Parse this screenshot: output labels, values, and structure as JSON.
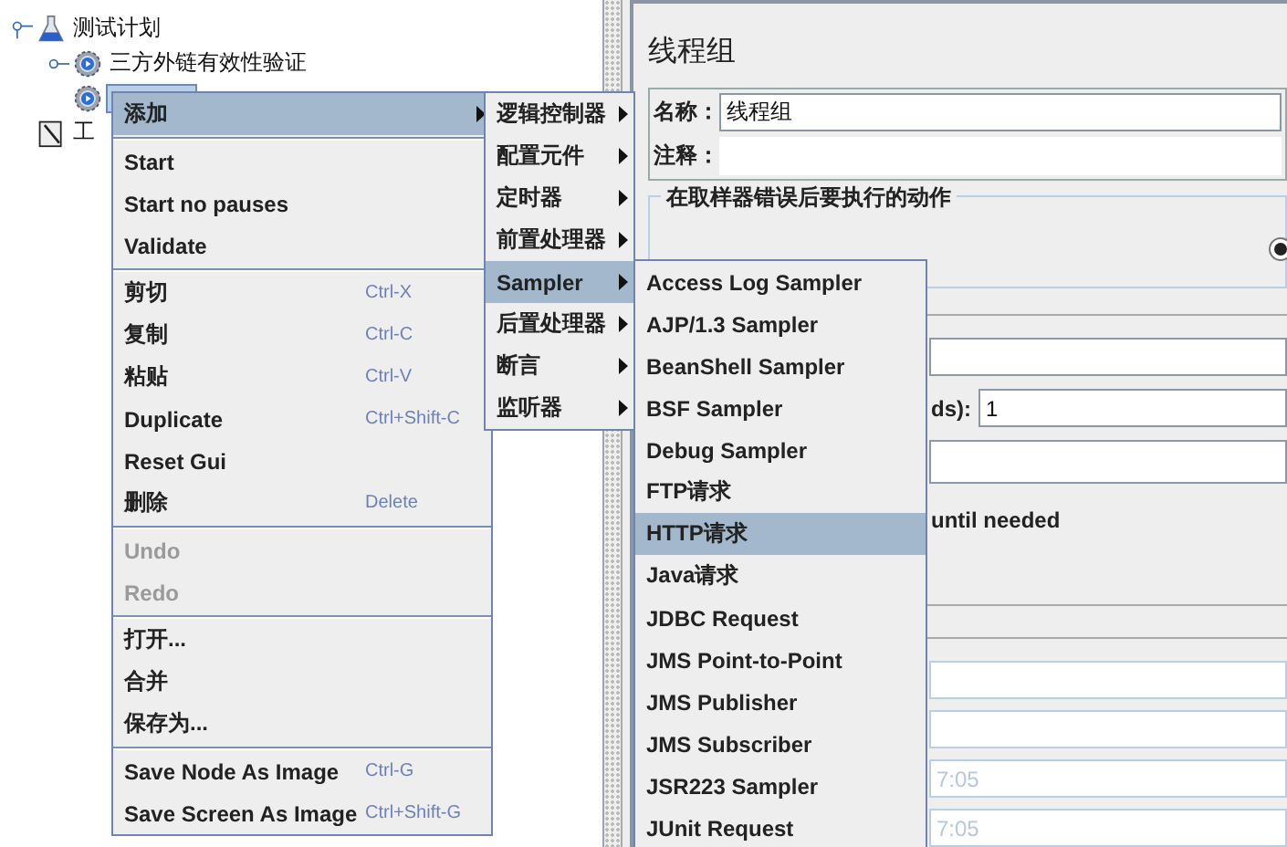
{
  "tree": {
    "items": [
      {
        "label": "测试计划",
        "kind": "plan",
        "selected": false,
        "expanded": true,
        "children": [
          {
            "label": "三方外链有效性验证",
            "kind": "thread-group",
            "selected": false,
            "expanded": false
          },
          {
            "kind": "thread-group",
            "selected": true
          }
        ]
      },
      {
        "label": "工",
        "kind": "workbench",
        "selected": false
      }
    ]
  },
  "panel": {
    "title": "线程组",
    "name_label": "名称：",
    "name_value": "线程组",
    "comment_label": "注释：",
    "error_group": {
      "legend": "在取样器错误后要执行的动作",
      "radio_selected": true
    },
    "threads_label": "ds):",
    "threads_value": "1",
    "delay_label": "until needed",
    "time_fields": [
      "7:05",
      "7:05"
    ]
  },
  "context_menu": {
    "groups": [
      [
        {
          "label": "添加",
          "selected": true,
          "disabled": false,
          "has_submenu": true
        }
      ],
      [
        {
          "label": "Start",
          "selected": false,
          "disabled": false,
          "has_submenu": false
        },
        {
          "label": "Start no pauses",
          "selected": false,
          "disabled": false,
          "has_submenu": false
        },
        {
          "label": "Validate",
          "selected": false,
          "disabled": false,
          "has_submenu": false
        }
      ],
      [
        {
          "label": "剪切",
          "shortcut": "Ctrl-X",
          "selected": false,
          "disabled": false,
          "has_submenu": false
        },
        {
          "label": "复制",
          "shortcut": "Ctrl-C",
          "selected": false,
          "disabled": false,
          "has_submenu": false
        },
        {
          "label": "粘贴",
          "shortcut": "Ctrl-V",
          "selected": false,
          "disabled": false,
          "has_submenu": false
        },
        {
          "label": "Duplicate",
          "shortcut": "Ctrl+Shift-C",
          "selected": false,
          "disabled": false,
          "has_submenu": false
        },
        {
          "label": "Reset Gui",
          "selected": false,
          "disabled": false,
          "has_submenu": false
        },
        {
          "label": "删除",
          "shortcut": "Delete",
          "selected": false,
          "disabled": false,
          "has_submenu": false
        }
      ],
      [
        {
          "label": "Undo",
          "selected": false,
          "disabled": true,
          "has_submenu": false
        },
        {
          "label": "Redo",
          "selected": false,
          "disabled": true,
          "has_submenu": false
        }
      ],
      [
        {
          "label": "打开...",
          "selected": false,
          "disabled": false,
          "has_submenu": false
        },
        {
          "label": "合并",
          "selected": false,
          "disabled": false,
          "has_submenu": false
        },
        {
          "label": "保存为...",
          "selected": false,
          "disabled": false,
          "has_submenu": false
        }
      ],
      [
        {
          "label": "Save Node As Image",
          "shortcut": "Ctrl-G",
          "selected": false,
          "disabled": false,
          "has_submenu": false
        },
        {
          "label": "Save Screen As Image",
          "shortcut": "Ctrl+Shift-G",
          "selected": false,
          "disabled": false,
          "has_submenu": false
        }
      ]
    ]
  },
  "add_menu": {
    "items": [
      {
        "label": "逻辑控制器",
        "selected": false,
        "has_submenu": true
      },
      {
        "label": "配置元件",
        "selected": false,
        "has_submenu": true
      },
      {
        "label": "定时器",
        "selected": false,
        "has_submenu": true
      },
      {
        "label": "前置处理器",
        "selected": false,
        "has_submenu": true
      },
      {
        "label": "Sampler",
        "selected": true,
        "has_submenu": true
      },
      {
        "label": "后置处理器",
        "selected": false,
        "has_submenu": true
      },
      {
        "label": "断言",
        "selected": false,
        "has_submenu": true
      },
      {
        "label": "监听器",
        "selected": false,
        "has_submenu": true
      }
    ]
  },
  "sampler_menu": {
    "items": [
      {
        "label": "Access Log Sampler",
        "selected": false
      },
      {
        "label": "AJP/1.3 Sampler",
        "selected": false
      },
      {
        "label": "BeanShell Sampler",
        "selected": false
      },
      {
        "label": "BSF Sampler",
        "selected": false
      },
      {
        "label": "Debug Sampler",
        "selected": false
      },
      {
        "label": "FTP请求",
        "selected": false
      },
      {
        "label": "HTTP请求",
        "selected": true
      },
      {
        "label": "Java请求",
        "selected": false
      },
      {
        "label": "JDBC Request",
        "selected": false
      },
      {
        "label": "JMS Point-to-Point",
        "selected": false
      },
      {
        "label": "JMS Publisher",
        "selected": false
      },
      {
        "label": "JMS Subscriber",
        "selected": false
      },
      {
        "label": "JSR223 Sampler",
        "selected": false
      },
      {
        "label": "JUnit Request",
        "selected": false
      }
    ]
  }
}
